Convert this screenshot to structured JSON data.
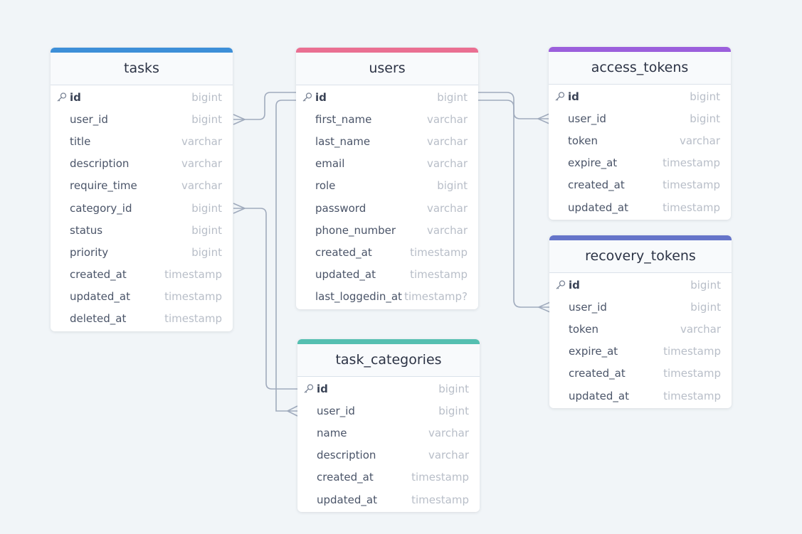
{
  "tables": [
    {
      "id": "tasks",
      "name": "tasks",
      "color": "#3d8fd8",
      "columns": [
        {
          "name": "id",
          "type": "bigint",
          "pk": true
        },
        {
          "name": "user_id",
          "type": "bigint"
        },
        {
          "name": "title",
          "type": "varchar"
        },
        {
          "name": "description",
          "type": "varchar"
        },
        {
          "name": "require_time",
          "type": "varchar"
        },
        {
          "name": "category_id",
          "type": "bigint"
        },
        {
          "name": "status",
          "type": "bigint"
        },
        {
          "name": "priority",
          "type": "bigint"
        },
        {
          "name": "created_at",
          "type": "timestamp"
        },
        {
          "name": "updated_at",
          "type": "timestamp"
        },
        {
          "name": "deleted_at",
          "type": "timestamp"
        }
      ]
    },
    {
      "id": "users",
      "name": "users",
      "color": "#ea6f92",
      "columns": [
        {
          "name": "id",
          "type": "bigint",
          "pk": true
        },
        {
          "name": "first_name",
          "type": "varchar"
        },
        {
          "name": "last_name",
          "type": "varchar"
        },
        {
          "name": "email",
          "type": "varchar"
        },
        {
          "name": "role",
          "type": "bigint"
        },
        {
          "name": "password",
          "type": "varchar"
        },
        {
          "name": "phone_number",
          "type": "varchar"
        },
        {
          "name": "created_at",
          "type": "timestamp"
        },
        {
          "name": "updated_at",
          "type": "timestamp"
        },
        {
          "name": "last_loggedin_at",
          "type": "timestamp?"
        }
      ]
    },
    {
      "id": "access_tokens",
      "name": "access_tokens",
      "color": "#9b5fdc",
      "columns": [
        {
          "name": "id",
          "type": "bigint",
          "pk": true
        },
        {
          "name": "user_id",
          "type": "bigint"
        },
        {
          "name": "token",
          "type": "varchar"
        },
        {
          "name": "expire_at",
          "type": "timestamp"
        },
        {
          "name": "created_at",
          "type": "timestamp"
        },
        {
          "name": "updated_at",
          "type": "timestamp"
        }
      ]
    },
    {
      "id": "recovery_tokens",
      "name": "recovery_tokens",
      "color": "#6574c9",
      "columns": [
        {
          "name": "id",
          "type": "bigint",
          "pk": true
        },
        {
          "name": "user_id",
          "type": "bigint"
        },
        {
          "name": "token",
          "type": "varchar"
        },
        {
          "name": "expire_at",
          "type": "timestamp"
        },
        {
          "name": "created_at",
          "type": "timestamp"
        },
        {
          "name": "updated_at",
          "type": "timestamp"
        }
      ]
    },
    {
      "id": "task_categories",
      "name": "task_categories",
      "color": "#55bfb1",
      "columns": [
        {
          "name": "id",
          "type": "bigint",
          "pk": true
        },
        {
          "name": "user_id",
          "type": "bigint"
        },
        {
          "name": "name",
          "type": "varchar"
        },
        {
          "name": "description",
          "type": "varchar"
        },
        {
          "name": "created_at",
          "type": "timestamp"
        },
        {
          "name": "updated_at",
          "type": "timestamp"
        }
      ]
    }
  ],
  "relationships": [
    {
      "from": "users.id",
      "to": "tasks.user_id",
      "cardinality": "one-to-many"
    },
    {
      "from": "users.id",
      "to": "task_categories.user_id",
      "cardinality": "one-to-many"
    },
    {
      "from": "users.id",
      "to": "access_tokens.user_id",
      "cardinality": "one-to-many"
    },
    {
      "from": "users.id",
      "to": "recovery_tokens.user_id",
      "cardinality": "one-to-many"
    },
    {
      "from": "task_categories.id",
      "to": "tasks.category_id",
      "cardinality": "one-to-many"
    }
  ]
}
